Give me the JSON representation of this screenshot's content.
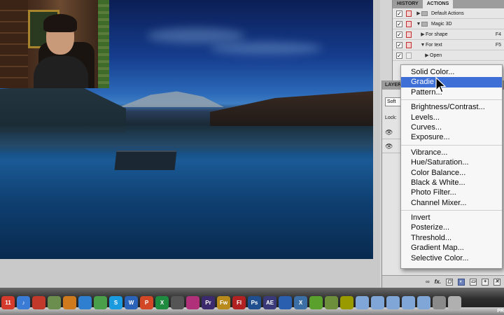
{
  "history_panel": {
    "tabs": [
      "HISTORY",
      "ACTIONS"
    ],
    "active_tab": "ACTIONS",
    "actions": [
      {
        "label": "Default Actions",
        "key": "",
        "type": "set",
        "expanded": false
      },
      {
        "label": "Magic 3D",
        "key": "",
        "type": "set",
        "expanded": true
      },
      {
        "label": "For shape",
        "key": "F4",
        "type": "action",
        "expanded": false
      },
      {
        "label": "For text",
        "key": "F5",
        "type": "action",
        "expanded": true
      },
      {
        "label": "Open",
        "key": "",
        "type": "step",
        "expanded": false
      }
    ]
  },
  "layers_panel": {
    "tab_label": "LAYER",
    "blend_mode": "Soft",
    "lock_label": "Lock:",
    "fx_label": "fx."
  },
  "context_menu": {
    "highlighted": "Gradient...",
    "groups": [
      [
        "Solid Color...",
        "Gradie",
        "Pattern..."
      ],
      [
        "Brightness/Contrast...",
        "Levels...",
        "Curves...",
        "Exposure..."
      ],
      [
        "Vibrance...",
        "Hue/Saturation...",
        "Color Balance...",
        "Black & White...",
        "Photo Filter...",
        "Channel Mixer..."
      ],
      [
        "Invert",
        "Posterize...",
        "Threshold...",
        "Gradient Map...",
        "Selective Color..."
      ]
    ]
  },
  "dock": {
    "calendar_day": "11",
    "apps": [
      {
        "name": "calendar",
        "label": "11",
        "color": "#d43b2c"
      },
      {
        "name": "itunes",
        "label": "♪",
        "color": "#3a7bd5"
      },
      {
        "name": "photo-booth",
        "label": "",
        "color": "#c0392b"
      },
      {
        "name": "iphoto",
        "label": "",
        "color": "#6b8e4e"
      },
      {
        "name": "garageband",
        "label": "",
        "color": "#d07a1e"
      },
      {
        "name": "safari",
        "label": "",
        "color": "#2f7fd1"
      },
      {
        "name": "chrome",
        "label": "",
        "color": "#4a9f4a"
      },
      {
        "name": "skype",
        "label": "S",
        "color": "#1a9be0"
      },
      {
        "name": "word",
        "label": "W",
        "color": "#2b63b8"
      },
      {
        "name": "powerpoint",
        "label": "P",
        "color": "#d24726"
      },
      {
        "name": "excel",
        "label": "X",
        "color": "#1e8b3e"
      },
      {
        "name": "final-cut",
        "label": "",
        "color": "#555555"
      },
      {
        "name": "motion",
        "label": "",
        "color": "#b0307a"
      },
      {
        "name": "premiere",
        "label": "Pr",
        "color": "#3b2a6e"
      },
      {
        "name": "fireworks",
        "label": "Fw",
        "color": "#b88a1b"
      },
      {
        "name": "flash",
        "label": "Fl",
        "color": "#b22222"
      },
      {
        "name": "photoshop",
        "label": "Ps",
        "color": "#1f4f8f"
      },
      {
        "name": "after-effects",
        "label": "AE",
        "color": "#3a3a7a"
      },
      {
        "name": "quicktime",
        "label": "",
        "color": "#2a5fb0"
      },
      {
        "name": "x11",
        "label": "X",
        "color": "#3b6fa5"
      },
      {
        "name": "evernote",
        "label": "",
        "color": "#5aa02c"
      },
      {
        "name": "minecraft",
        "label": "",
        "color": "#6d8f3b"
      },
      {
        "name": "utility",
        "label": "",
        "color": "#999900"
      },
      {
        "name": "folder-1",
        "label": "",
        "color": "#7fa6d6"
      },
      {
        "name": "folder-2",
        "label": "",
        "color": "#7fa6d6"
      },
      {
        "name": "folder-3",
        "label": "",
        "color": "#7fa6d6"
      },
      {
        "name": "folder-4",
        "label": "",
        "color": "#7fa6d6"
      },
      {
        "name": "folder-5",
        "label": "",
        "color": "#7fa6d6"
      },
      {
        "name": "screen-capture",
        "label": "",
        "color": "#8a8a8a"
      },
      {
        "name": "trash",
        "label": "",
        "color": "#b0b0b0"
      }
    ],
    "corner_label": "PR"
  }
}
